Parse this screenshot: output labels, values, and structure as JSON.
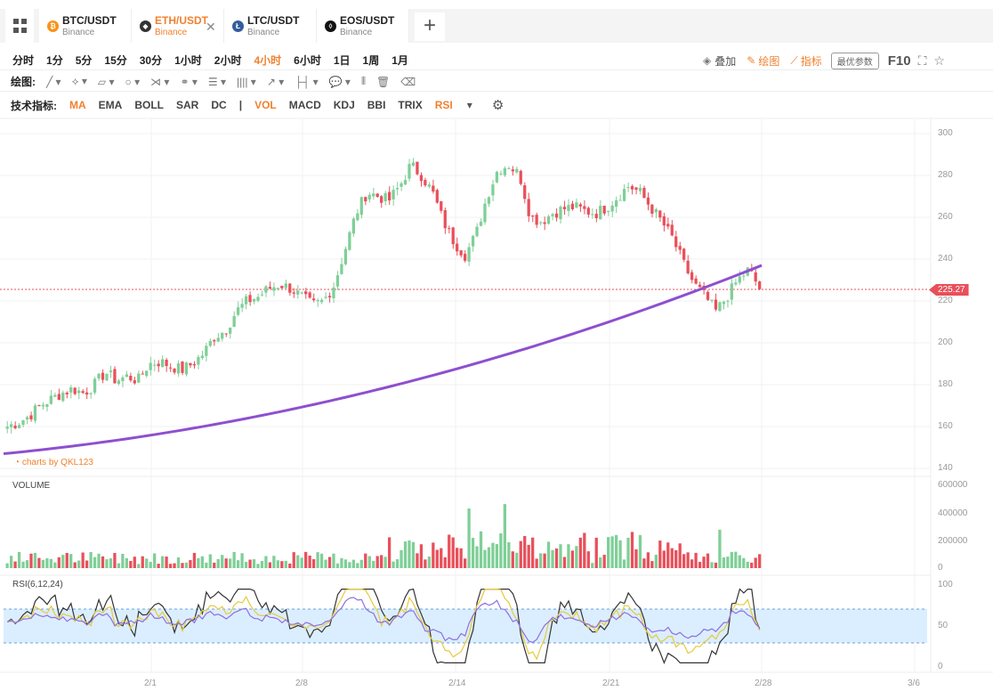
{
  "tabs": [
    {
      "symbol": "BTC/USDT",
      "exchange": "Binance",
      "icon": "bitcoin-icon",
      "color": "#f7931a",
      "glyph": "₿"
    },
    {
      "symbol": "ETH/USDT",
      "exchange": "Binance",
      "icon": "ethereum-icon",
      "color": "#333",
      "glyph": "◆",
      "active": true
    },
    {
      "symbol": "LTC/USDT",
      "exchange": "Binance",
      "icon": "litecoin-icon",
      "color": "#345d9d",
      "glyph": "Ł"
    },
    {
      "symbol": "EOS/USDT",
      "exchange": "Binance",
      "icon": "eos-icon",
      "color": "#111",
      "glyph": "◊"
    }
  ],
  "intervals": [
    "分时",
    "1分",
    "5分",
    "15分",
    "30分",
    "1小时",
    "2小时",
    "4小时",
    "6小时",
    "1日",
    "1周",
    "1月"
  ],
  "active_interval": "4小时",
  "toolbar_right": {
    "overlay": "叠加",
    "draw": "绘图",
    "indicator": "指标",
    "best_params": "最优参数",
    "f10": "F10"
  },
  "draw_label": "绘图:",
  "indicators_label": "技术指标:",
  "indicators": [
    "MA",
    "EMA",
    "BOLL",
    "SAR",
    "DC",
    "|",
    "VOL",
    "MACD",
    "KDJ",
    "BBI",
    "TRIX",
    "RSI"
  ],
  "active_indicators": [
    "MA",
    "VOL",
    "RSI"
  ],
  "watermark": "charts by QKL123",
  "price_axis": [
    "300",
    "280",
    "260",
    "240",
    "220",
    "200",
    "180",
    "160",
    "140"
  ],
  "current_price": "225.27",
  "volume_label": "VOLUME",
  "volume_axis": [
    "600000",
    "400000",
    "200000",
    "0"
  ],
  "rsi_label": "RSI(6,12,24)",
  "rsi_axis": [
    "100",
    "50",
    "0"
  ],
  "x_labels": [
    "2/1",
    "2/8",
    "2/14",
    "2/21",
    "2/28",
    "3/6"
  ],
  "colors": {
    "up": "#7fcf97",
    "down": "#e8505b",
    "ma": "#8e4fcf",
    "accent": "#f0812f",
    "rsi_band": "#dbeeff"
  },
  "chart_data": {
    "type": "candlestick",
    "ylim": [
      140,
      300
    ],
    "current": 225.27,
    "volume_ylim": [
      0,
      600000
    ],
    "rsi_ylim": [
      0,
      100
    ],
    "rsi_band": [
      30,
      70
    ],
    "close_path": [
      160,
      162,
      165,
      170,
      173,
      176,
      178,
      176,
      180,
      186,
      182,
      184,
      182,
      190,
      191,
      189,
      187,
      190,
      195,
      203,
      206,
      215,
      220,
      222,
      226,
      228,
      226,
      222,
      218,
      220,
      228,
      245,
      262,
      272,
      270,
      268,
      275,
      285,
      280,
      272,
      258,
      248,
      242,
      252,
      270,
      283,
      285,
      280,
      260,
      258,
      262,
      264,
      265,
      263,
      262,
      265,
      270,
      275,
      272,
      265,
      258,
      250,
      238,
      228,
      222,
      215,
      222,
      230,
      235,
      226
    ]
  }
}
